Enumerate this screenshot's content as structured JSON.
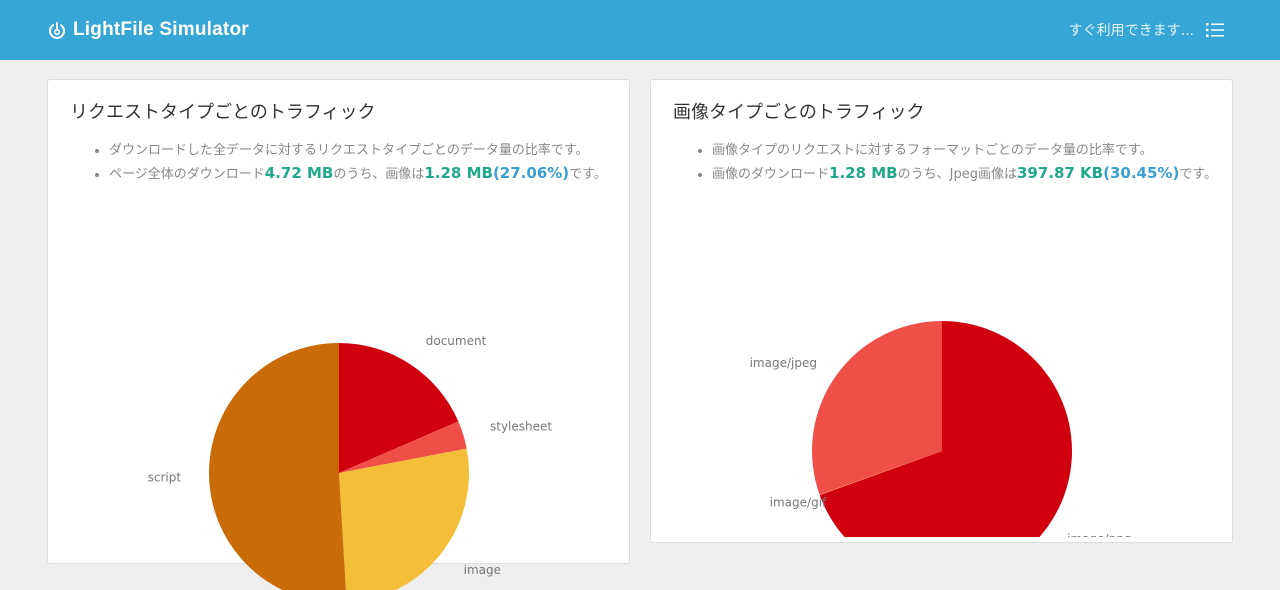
{
  "header": {
    "brand": "LightFile Simulator",
    "status": "すぐ利用できます...",
    "colors": {
      "bar": "#36a6d6"
    }
  },
  "cards": [
    {
      "title": "リクエストタイプごとのトラフィック",
      "bullets": [
        {
          "parts": [
            {
              "text": "ダウンロードした全データに対するリクエストタイプごとのデータ量の比率です。"
            }
          ]
        },
        {
          "parts": [
            {
              "text": "ページ全体のダウンロード"
            },
            {
              "text": "4.72 MB",
              "style": "green"
            },
            {
              "text": "のうち、画像は"
            },
            {
              "text": "1.28 MB",
              "style": "green"
            },
            {
              "text": "(27.06%)",
              "style": "blue"
            },
            {
              "text": "です。"
            }
          ]
        }
      ]
    },
    {
      "title": "画像タイプごとのトラフィック",
      "bullets": [
        {
          "parts": [
            {
              "text": "画像タイプのリクエストに対するフォーマットごとのデータ量の比率です。"
            }
          ]
        },
        {
          "parts": [
            {
              "text": "画像のダウンロード"
            },
            {
              "text": "1.28 MB",
              "style": "green"
            },
            {
              "text": "のうち、Jpeg画像は"
            },
            {
              "text": "397.87 KB",
              "style": "green"
            },
            {
              "text": "(30.45%)",
              "style": "blue"
            },
            {
              "text": "です。"
            }
          ]
        }
      ]
    }
  ],
  "chart_data": [
    {
      "type": "pie",
      "title": "",
      "start": "top, clockwise",
      "labels": [
        "document",
        "stylesheet",
        "image",
        "script"
      ],
      "values": [
        18.5,
        3.5,
        27.06,
        50.94
      ],
      "colors": [
        "#d0000f",
        "#ef4f47",
        "#f4be38",
        "#c96c08"
      ]
    },
    {
      "type": "pie",
      "title": "",
      "start": "top, clockwise",
      "labels": [
        "image/png",
        "image/gif",
        "image/jpeg"
      ],
      "values": [
        69.5,
        0.05,
        30.45
      ],
      "colors": [
        "#d0000f",
        "#f4be38",
        "#ef4f47"
      ]
    }
  ]
}
